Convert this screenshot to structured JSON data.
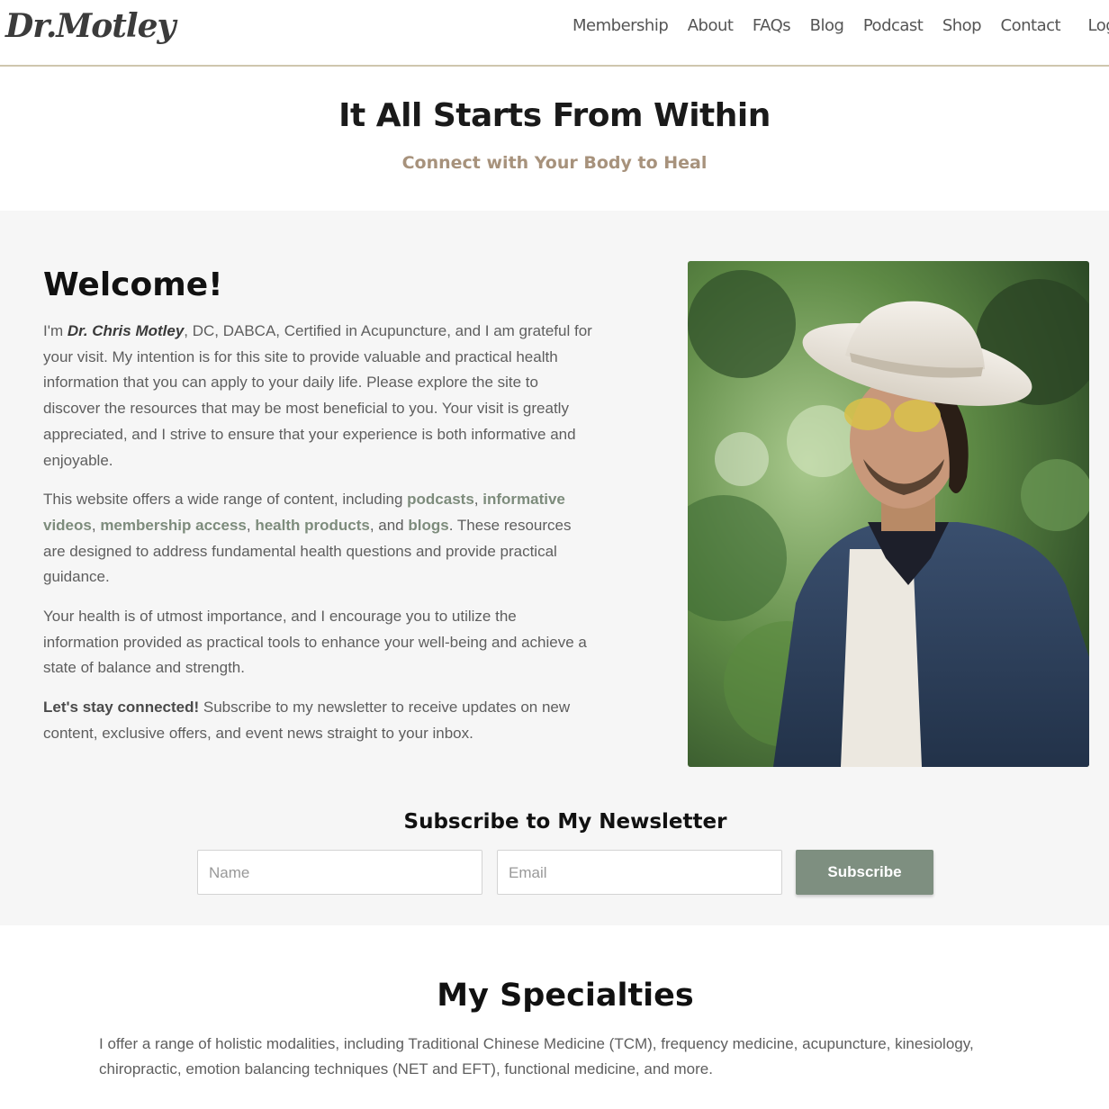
{
  "header": {
    "logo": "Dr.Motley",
    "nav": [
      "Membership",
      "About",
      "FAQs",
      "Blog",
      "Podcast",
      "Shop",
      "Contact"
    ],
    "login": "Log In"
  },
  "hero": {
    "title": "It All Starts From Within",
    "subtitle": "Connect with Your Body to Heal"
  },
  "welcome": {
    "title": "Welcome!",
    "p1_prefix": "I'm ",
    "p1_name": "Dr. Chris Motley",
    "p1_rest": ", DC, DABCA, Certified in Acupuncture, and I am grateful for your visit. My intention is for this site to provide valuable and practical health information that you can apply to your daily life. Please explore the site to discover the resources that may be most beneficial to you. Your visit is greatly appreciated, and I strive to ensure that your experience is both informative and enjoyable.",
    "p2_a": "This website offers a wide range of content, including ",
    "p2_link1": "podcasts",
    "p2_b": ", ",
    "p2_link2": "informative videos",
    "p2_c": ", ",
    "p2_link3": "membership access",
    "p2_d": ", ",
    "p2_link4": "health products",
    "p2_e": ", and ",
    "p2_link5": "blogs",
    "p2_f": ". These resources are designed to address fundamental health questions and provide practical guidance.",
    "p3": "Your health is of utmost importance, and I encourage you to utilize the information provided as practical tools to enhance your well-being and achieve a state of balance and strength.",
    "p4_lead": "Let's stay connected!",
    "p4_rest": " Subscribe to my newsletter to receive updates on new content, exclusive offers, and event news straight to your inbox."
  },
  "newsletter": {
    "title": "Subscribe to My Newsletter",
    "name_placeholder": "Name",
    "email_placeholder": "Email",
    "button": "Subscribe"
  },
  "specialties": {
    "title": "My Specialties",
    "text": "I offer a range of holistic modalities, including Traditional Chinese Medicine (TCM), frequency medicine, acupuncture, kinesiology, chiropractic, emotion balancing techniques (NET and EFT), functional medicine, and more."
  }
}
